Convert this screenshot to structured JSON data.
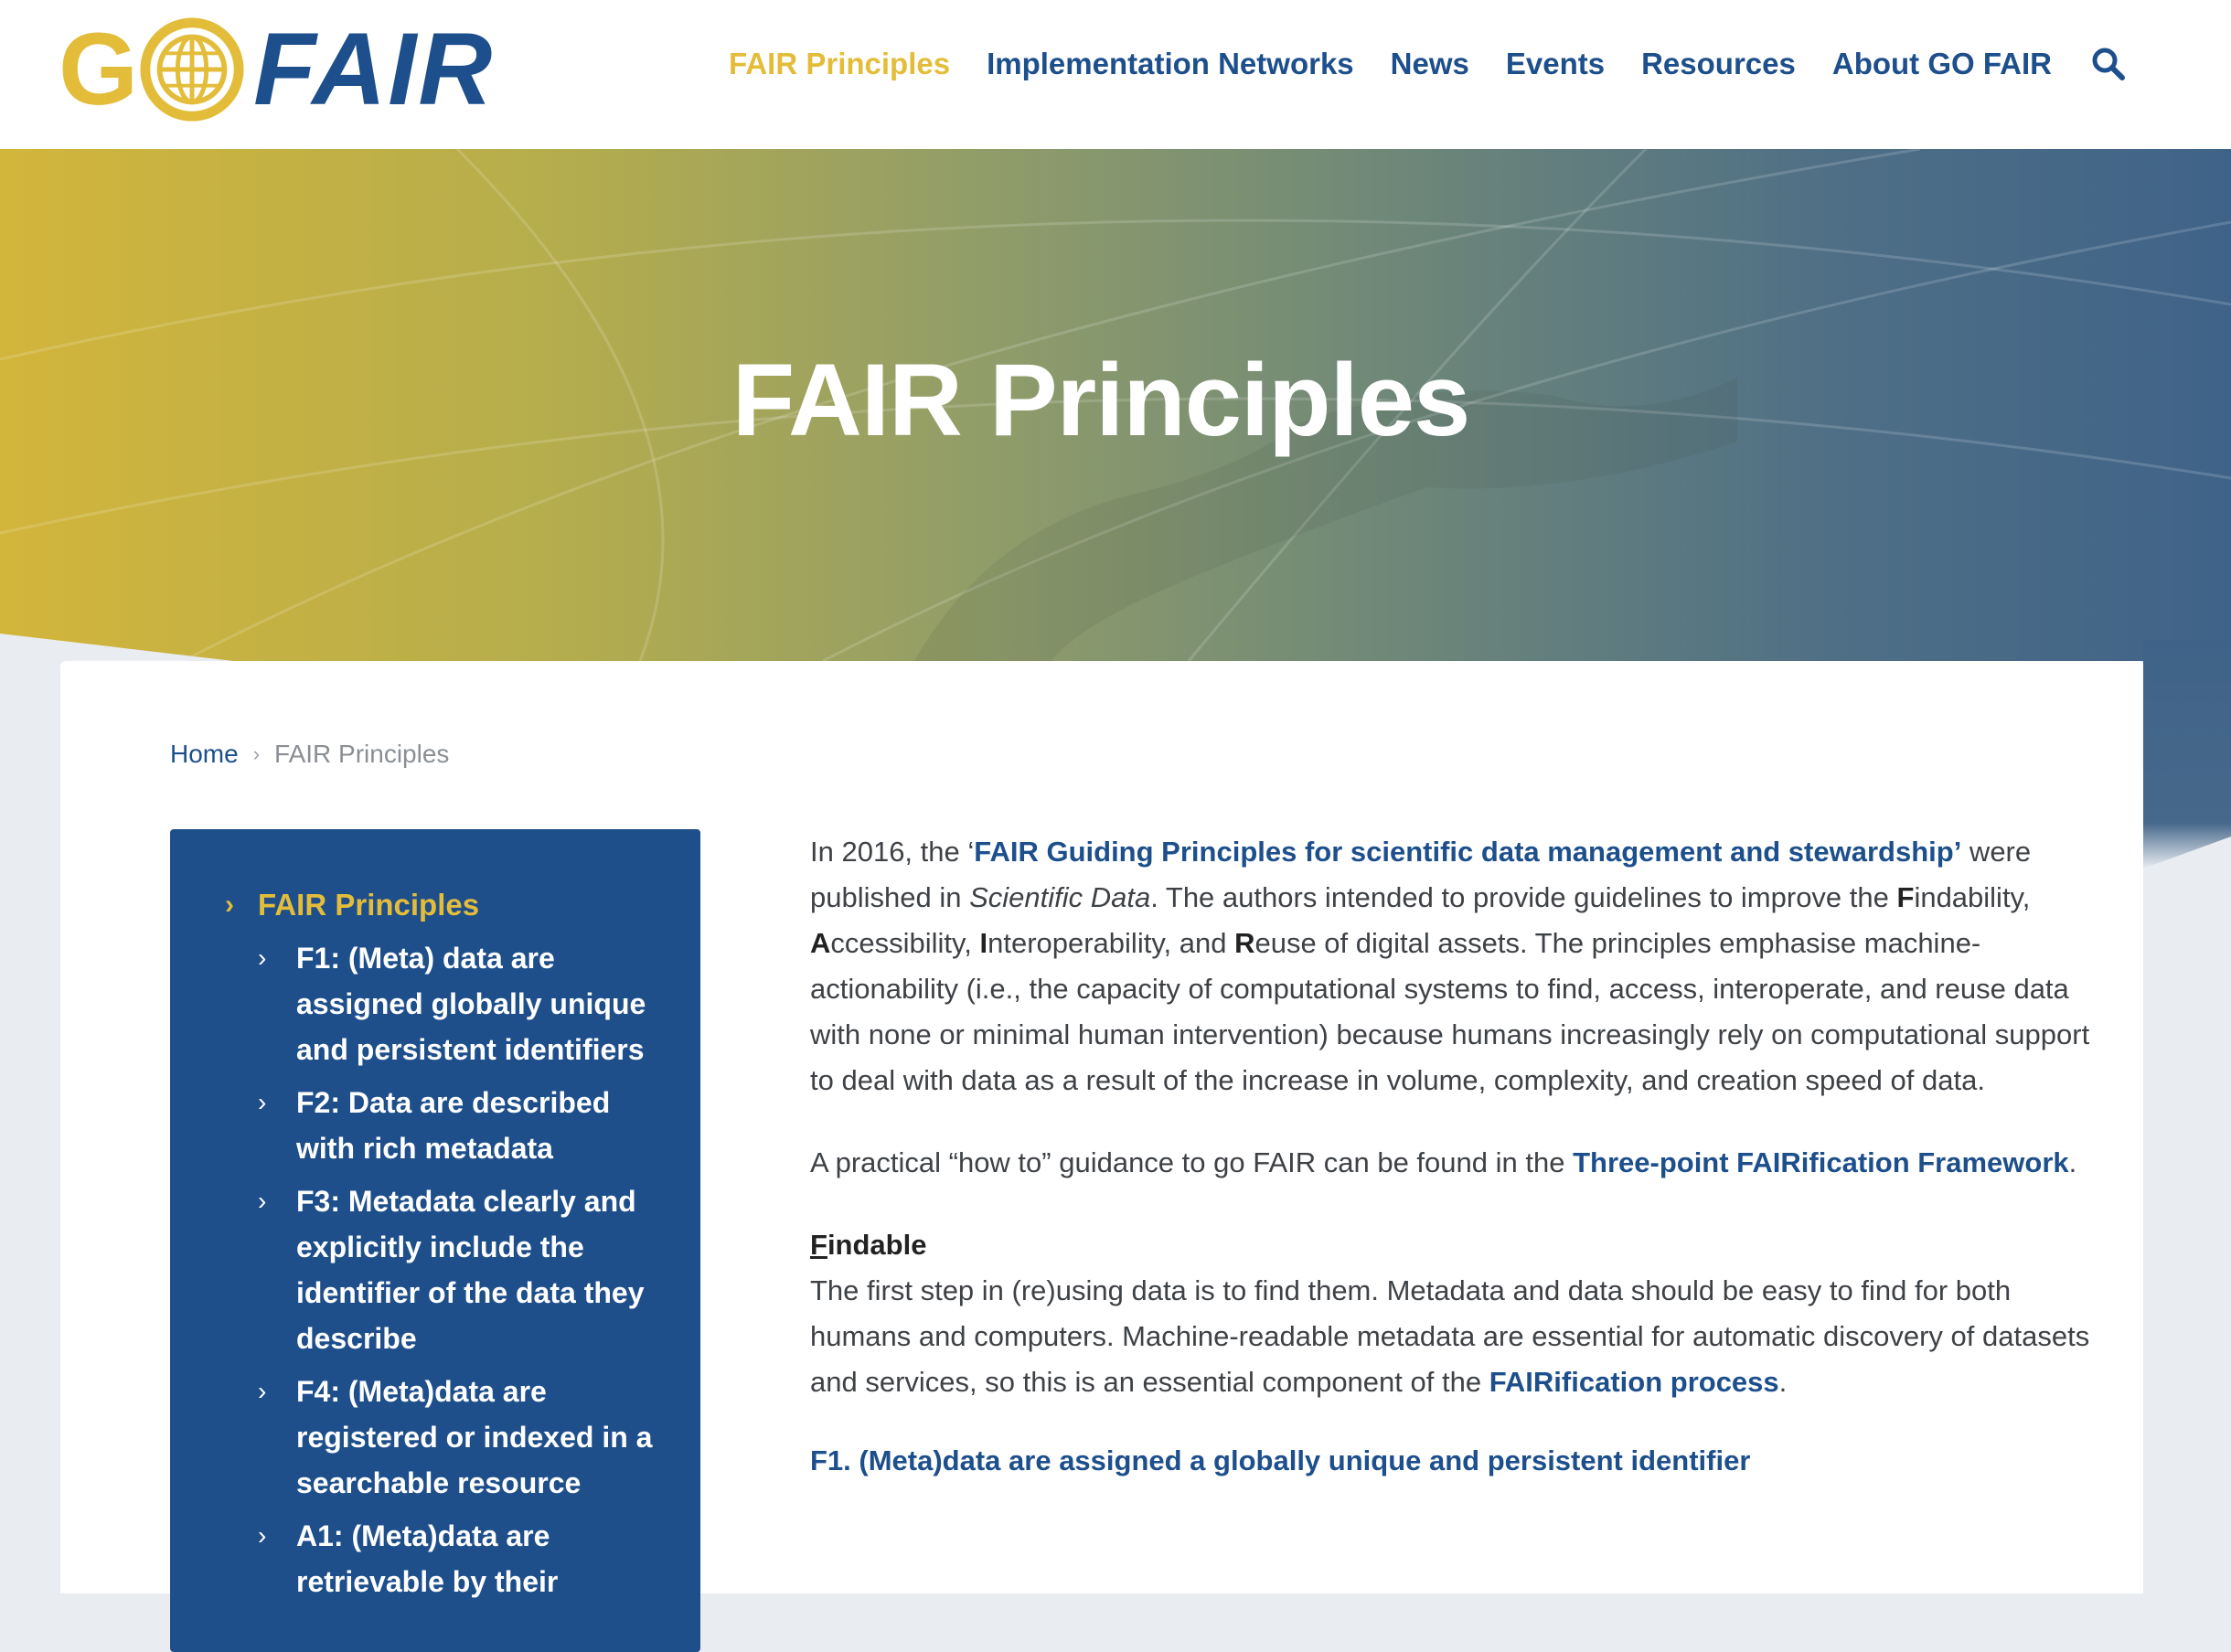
{
  "colors": {
    "brand_blue": "#1d4f8c",
    "brand_gold": "#e3bd3a",
    "sidebar_bg": "#1e4f8b"
  },
  "logo": {
    "go": "G",
    "globe_icon": "globe-icon",
    "fair": "FAIR"
  },
  "nav": {
    "items": [
      {
        "label": "FAIR Principles",
        "active": true
      },
      {
        "label": "Implementation Networks"
      },
      {
        "label": "News"
      },
      {
        "label": "Events"
      },
      {
        "label": "Resources"
      },
      {
        "label": "About GO FAIR"
      }
    ],
    "search_icon": "search-icon"
  },
  "hero": {
    "title": "FAIR Principles"
  },
  "breadcrumb": {
    "home": "Home",
    "sep": "›",
    "current": "FAIR Principles"
  },
  "sidebar": {
    "root": "FAIR Principles",
    "chevron": "›",
    "items": [
      {
        "label": "F1: (Meta) data are assigned globally unique and persistent identifiers"
      },
      {
        "label": "F2: Data are described with rich metadata"
      },
      {
        "label": "F3: Metadata clearly and explicitly include the identifier of the data they describe"
      },
      {
        "label": "F4: (Meta)data are registered or indexed in a searchable resource"
      },
      {
        "label": "A1: (Meta)data are retrievable by their"
      }
    ]
  },
  "content": {
    "p1_a": "In 2016, the ‘",
    "p1_link": "FAIR Guiding Principles for scientific data management and stewardship’",
    "p1_b": " were published in ",
    "p1_journal": "Scientific Data",
    "p1_c": ". The authors intended to provide guidelines to improve the ",
    "k_f": "F",
    "w_f": "indability, ",
    "k_a": "A",
    "w_a": "ccessibility, ",
    "k_i": "I",
    "w_i": "nteroperability, and ",
    "k_r": "R",
    "w_r": "euse of digital assets. The principles emphasise machine-actionability (i.e., the capacity of computational systems to find, access, interoperate, and reuse data with none or minimal human intervention) because humans increasingly rely on computational support to deal with data as a result of the increase in volume, complexity, and creation speed of data.",
    "p2_a": "A practical “how to” guidance to go FAIR can be found in the ",
    "p2_link": "Three-point FAIRification Framework",
    "p2_b": ".",
    "findable_k": "F",
    "findable_rest": "indable",
    "p3_a": "The first step in (re)using data is to find them. Metadata and data should be easy to find for both humans and computers. Machine-readable metadata are essential for automatic discovery of datasets and services, so this is an essential component of the ",
    "p3_link": "FAIRification process",
    "p3_b": ".",
    "f1_heading": "F1. (Meta)data are assigned a globally unique and persistent identifier"
  }
}
